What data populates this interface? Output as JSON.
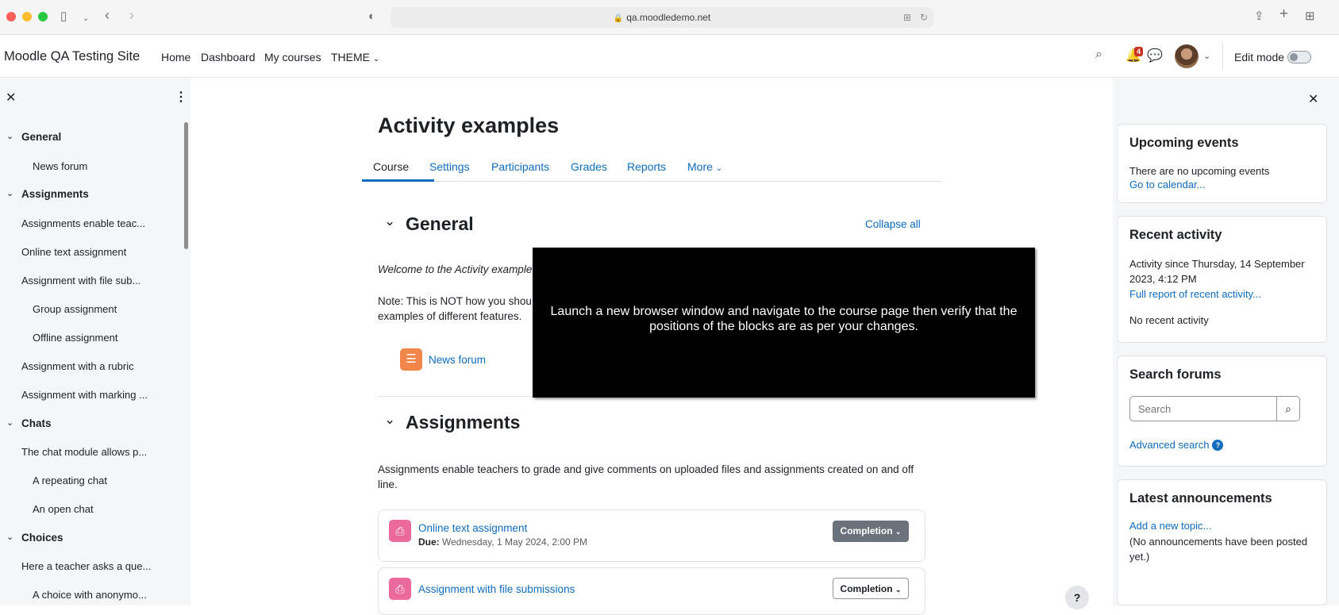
{
  "browser": {
    "url": "qa.moodledemo.net"
  },
  "nav": {
    "site_name": "Moodle QA Testing Site",
    "links": [
      "Home",
      "Dashboard",
      "My courses",
      "THEME"
    ],
    "notification_count": "4",
    "edit_mode_label": "Edit mode"
  },
  "course_index": {
    "items": [
      {
        "label": "General",
        "type": "section"
      },
      {
        "label": "News forum",
        "type": "activity"
      },
      {
        "label": "Assignments",
        "type": "section"
      },
      {
        "label": "Assignments enable teac...",
        "type": "label"
      },
      {
        "label": "Online text assignment",
        "type": "label"
      },
      {
        "label": "Assignment with file sub...",
        "type": "label"
      },
      {
        "label": "Group assignment",
        "type": "activity"
      },
      {
        "label": "Offline assignment",
        "type": "activity"
      },
      {
        "label": "Assignment with a rubric",
        "type": "label"
      },
      {
        "label": "Assignment with marking ...",
        "type": "label"
      },
      {
        "label": "Chats",
        "type": "section"
      },
      {
        "label": "The chat module allows p...",
        "type": "label"
      },
      {
        "label": "A repeating chat",
        "type": "activity"
      },
      {
        "label": "An open chat",
        "type": "activity"
      },
      {
        "label": "Choices",
        "type": "section"
      },
      {
        "label": "Here a teacher asks a que...",
        "type": "label"
      },
      {
        "label": "A choice with anonymo...",
        "type": "activity"
      }
    ]
  },
  "main": {
    "title": "Activity examples",
    "tabs": [
      "Course",
      "Settings",
      "Participants",
      "Grades",
      "Reports",
      "More"
    ],
    "collapse_all": "Collapse all",
    "general": {
      "title": "General",
      "welcome": "Welcome to the Activity example",
      "note_line1": "Note: This is NOT how you shou",
      "note_line2": "examples of different features.",
      "news_forum": "News forum"
    },
    "assignments": {
      "title": "Assignments",
      "description": "Assignments enable teachers to grade and give comments on uploaded files and assignments created on and off line.",
      "activities": [
        {
          "name": "Online text assignment",
          "due_label": "Due:",
          "due": "Wednesday, 1 May 2024, 2:00 PM",
          "completion": "Completion"
        },
        {
          "name": "Assignment with file submissions",
          "completion": "Completion"
        }
      ]
    }
  },
  "overlay": {
    "text": "Launch a new browser window and navigate to the course page then verify that the positions of the blocks are as per your changes."
  },
  "blocks": {
    "upcoming": {
      "title": "Upcoming events",
      "text": "There are no upcoming events",
      "link": "Go to calendar..."
    },
    "recent": {
      "title": "Recent activity",
      "since": "Activity since Thursday, 14 September 2023, 4:12 PM",
      "link": "Full report of recent activity...",
      "none": "No recent activity"
    },
    "search": {
      "title": "Search forums",
      "placeholder": "Search",
      "advanced": "Advanced search"
    },
    "announcements": {
      "title": "Latest announcements",
      "link": "Add a new topic...",
      "none": "(No announcements have been posted yet.)"
    }
  },
  "help": "?"
}
